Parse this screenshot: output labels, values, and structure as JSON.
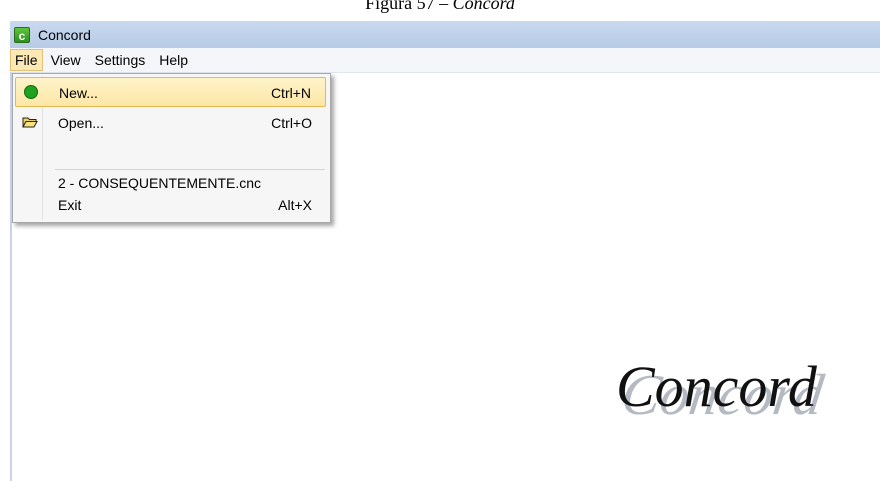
{
  "caption": {
    "prefix": "Figura 57 – ",
    "app_name": "Concord"
  },
  "window": {
    "title": "Concord",
    "icon_letter": "c"
  },
  "menubar": {
    "items": [
      {
        "label": "File",
        "active": true
      },
      {
        "label": "View",
        "active": false
      },
      {
        "label": "Settings",
        "active": false
      },
      {
        "label": "Help",
        "active": false
      }
    ]
  },
  "file_menu": {
    "items": [
      {
        "label": "New...",
        "shortcut": "Ctrl+N",
        "icon": "green-dot-icon",
        "highlighted": true
      },
      {
        "label": "Open...",
        "shortcut": "Ctrl+O",
        "icon": "folder-open-icon",
        "highlighted": false
      },
      {
        "label": "2 - CONSEQUENTEMENTE.cnc",
        "shortcut": "",
        "icon": "",
        "highlighted": false
      },
      {
        "label": "Exit",
        "shortcut": "Alt+X",
        "icon": "",
        "highlighted": false
      }
    ]
  },
  "workspace": {
    "logo_text": "Concord"
  },
  "colors": {
    "titlebar": "#c9d9ef",
    "menu_highlight": "#fde7a6",
    "app_icon": "#3fa52a"
  }
}
